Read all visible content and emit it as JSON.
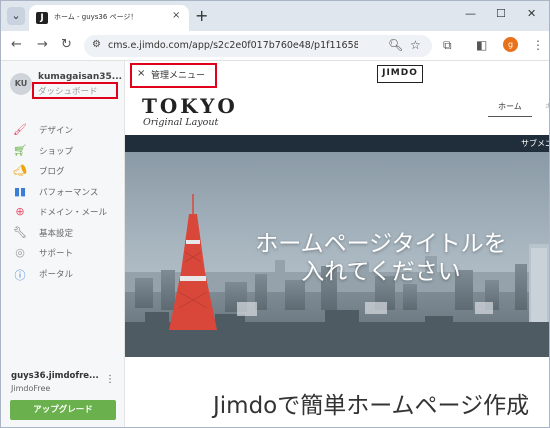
{
  "browser": {
    "tab_title": "ホーム - guys36 ページ！",
    "tab_favicon": "J",
    "tab_close": "×",
    "new_tab": "+",
    "url": "cms.e.jimdo.com/app/s2c2e0f017b760e48/p1f11658d620084fe...",
    "profile_initial": "g",
    "icons": [
      "back-icon",
      "forward-icon",
      "reload-icon",
      "site-info-icon",
      "zoom-icon",
      "bookmark-star-icon",
      "extensions-icon",
      "sidepanel-icon",
      "menu-icon"
    ]
  },
  "sidebar": {
    "avatar_initials": "KU",
    "user_name": "kumagaisan35...",
    "dashboard_link": "ダッシュボード",
    "items": [
      {
        "label": "デザイン",
        "icon": "paint-roller-icon",
        "color": "#e94e6b"
      },
      {
        "label": "ショップ",
        "icon": "cart-icon",
        "color": "#6ab04c"
      },
      {
        "label": "ブログ",
        "icon": "megaphone-icon",
        "color": "#f0a30a"
      },
      {
        "label": "パフォーマンス",
        "icon": "bar-chart-icon",
        "color": "#3b7dd8"
      },
      {
        "label": "ドメイン・メール",
        "icon": "globe-icon",
        "color": "#e94e6b"
      },
      {
        "label": "基本設定",
        "icon": "wrench-icon",
        "color": "#666666"
      },
      {
        "label": "サポート",
        "icon": "help-icon",
        "color": "#999999"
      },
      {
        "label": "ポータル",
        "icon": "question-icon",
        "color": "#3b7dd8"
      }
    ],
    "site_name": "guys36.jimdofre...",
    "plan": "JimdoFree",
    "upgrade_label": "アップグレード"
  },
  "main": {
    "admin_close": "×",
    "admin_label": "管理メニュー",
    "jimdo_logo": "JIMDO",
    "logo_title": "TOKYO",
    "logo_subtitle": "Original Layout",
    "nav_home": "ホーム",
    "nav_next": "ギ",
    "subnav_label": "サブメニ",
    "hero_title": "ホームページタイトルを 入れてください",
    "bottom_title": "Jimdoで簡単ホームページ作成"
  },
  "colors": {
    "highlight_box": "#e0001b",
    "upgrade_button": "#6ab04c",
    "subnav_bar": "#1f2e3a"
  }
}
